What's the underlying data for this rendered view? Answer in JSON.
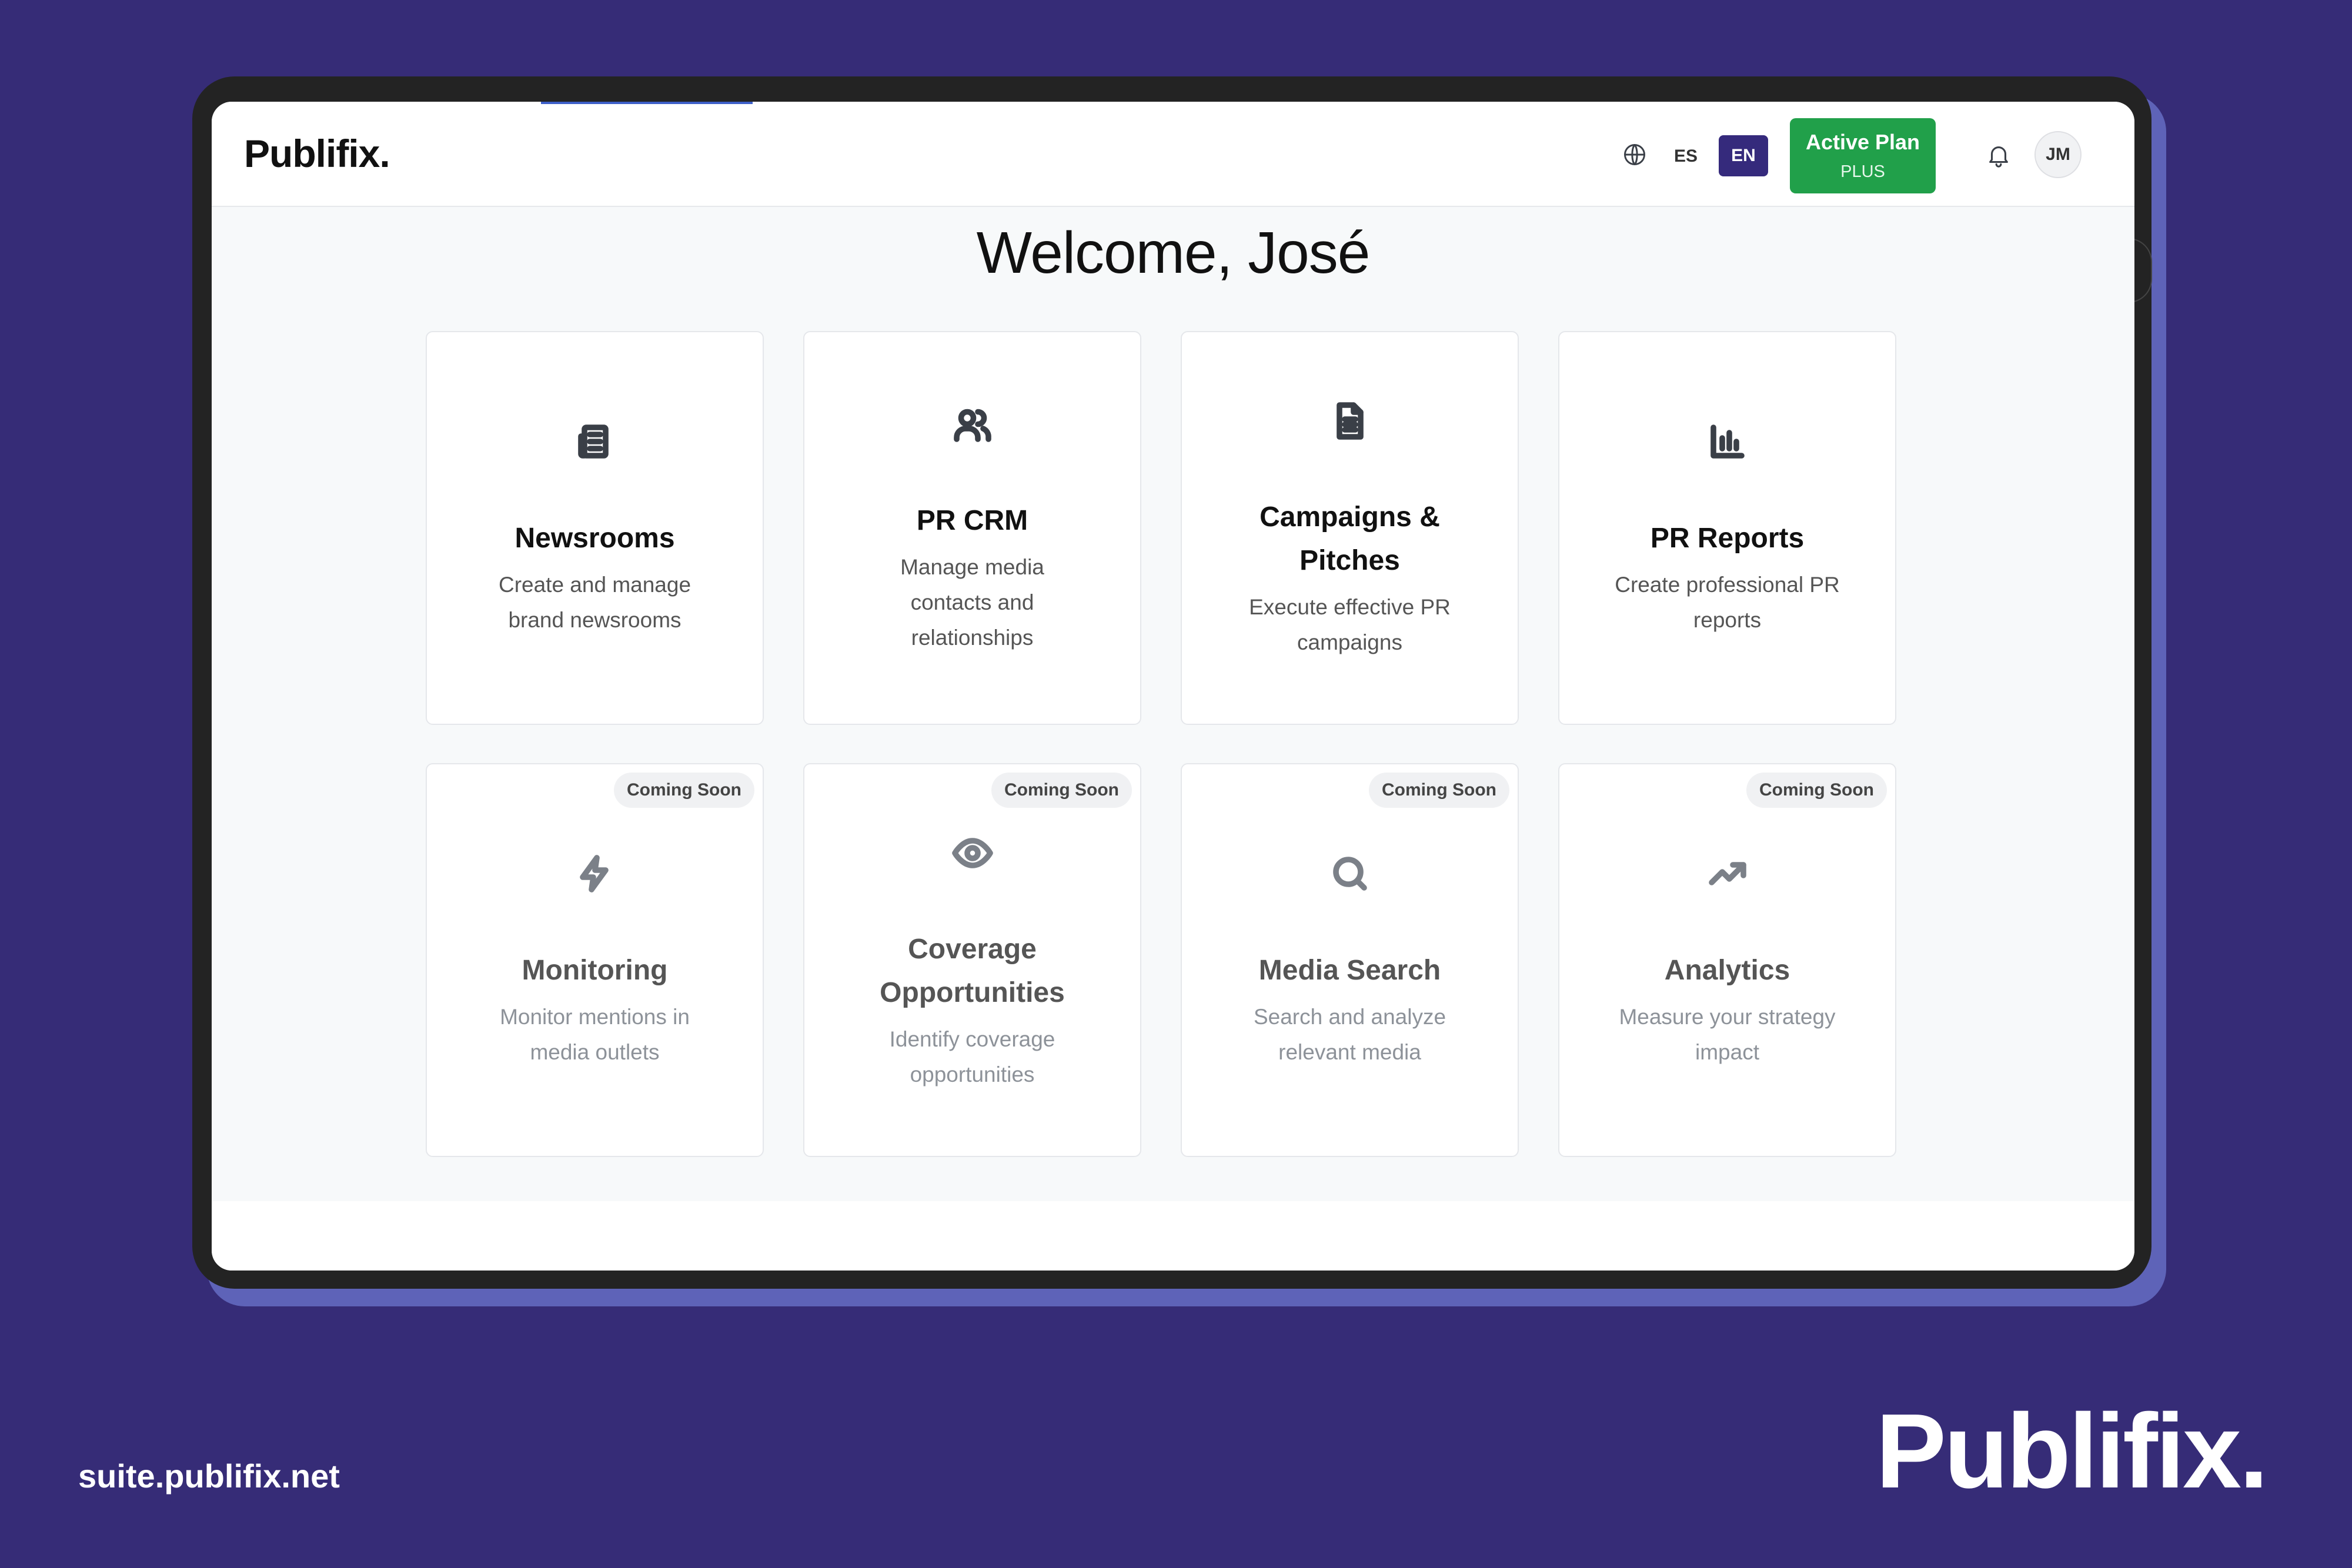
{
  "app": {
    "logo": "Publifix."
  },
  "header": {
    "lang_es": "ES",
    "lang_en": "EN",
    "plan_title": "Active Plan",
    "plan_sub": "PLUS",
    "avatar_initials": "JM"
  },
  "main": {
    "welcome": "Welcome, José",
    "cards": [
      {
        "title": "Newsrooms",
        "desc": "Create and manage brand newsrooms",
        "icon": "newspaper-icon"
      },
      {
        "title": "PR CRM",
        "desc": "Manage media contacts and relationships",
        "icon": "users-icon"
      },
      {
        "title": "Campaigns & Pitches",
        "desc": "Execute effective PR campaigns",
        "icon": "document-icon"
      },
      {
        "title": "PR Reports",
        "desc": "Create professional PR reports",
        "icon": "bar-chart-icon"
      },
      {
        "title": "Monitoring",
        "desc": "Monitor mentions in media outlets",
        "icon": "lightning-icon",
        "badge": "Coming Soon"
      },
      {
        "title": "Coverage Opportunities",
        "desc": "Identify coverage opportunities",
        "icon": "eye-icon",
        "badge": "Coming Soon"
      },
      {
        "title": "Media Search",
        "desc": "Search and analyze relevant media",
        "icon": "search-icon",
        "badge": "Coming Soon"
      },
      {
        "title": "Analytics",
        "desc": "Measure your strategy impact",
        "icon": "trend-up-icon",
        "badge": "Coming Soon"
      }
    ]
  },
  "footer": {
    "url": "suite.publifix.net",
    "brand": "Publifix."
  },
  "colors": {
    "background": "#362c77",
    "accent": "#352a7c",
    "plan_green": "#21a04a"
  }
}
